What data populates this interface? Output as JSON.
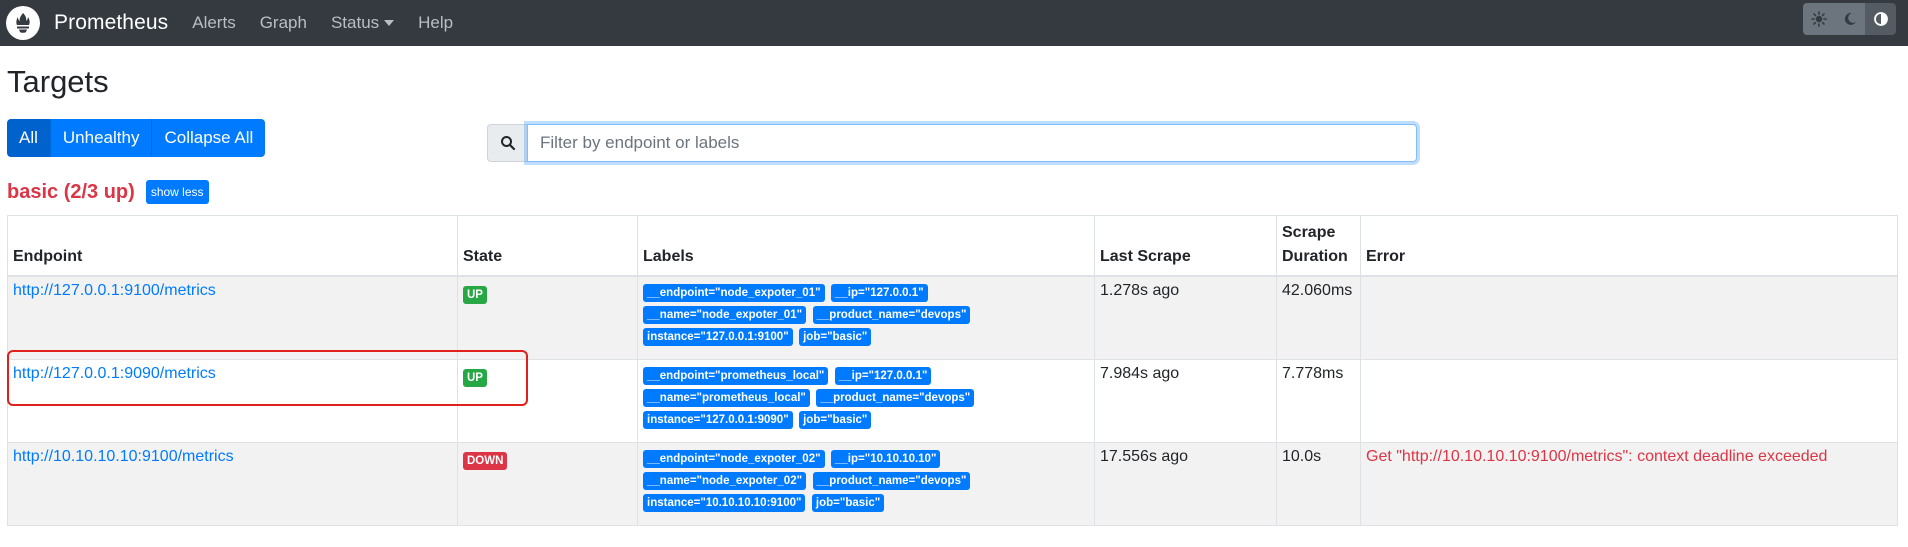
{
  "navbar": {
    "brand": "Prometheus",
    "links": [
      "Alerts",
      "Graph",
      "Status",
      "Help"
    ],
    "theme_icons": [
      "sun-icon",
      "moon-icon",
      "adjust-icon"
    ]
  },
  "page": {
    "title": "Targets"
  },
  "filter_buttons": [
    "All",
    "Unhealthy",
    "Collapse All"
  ],
  "search": {
    "placeholder": "Filter by endpoint or labels"
  },
  "pool": {
    "title": "basic (2/3 up)",
    "toggle_label": "show less"
  },
  "table": {
    "headers": {
      "endpoint": "Endpoint",
      "state": "State",
      "labels": "Labels",
      "last_scrape": "Last Scrape",
      "scrape_duration_1": "Scrape",
      "scrape_duration_2": "Duration",
      "error": "Error"
    },
    "rows": [
      {
        "endpoint": "http://127.0.0.1:9100/metrics",
        "state": "UP",
        "labels": [
          "__endpoint=\"node_expoter_01\"",
          "__ip=\"127.0.0.1\"",
          "__name=\"node_expoter_01\"",
          "__product_name=\"devops\"",
          "instance=\"127.0.0.1:9100\"",
          "job=\"basic\""
        ],
        "last_scrape": "1.278s ago",
        "scrape_duration": "42.060ms",
        "error": ""
      },
      {
        "endpoint": "http://127.0.0.1:9090/metrics",
        "state": "UP",
        "labels": [
          "__endpoint=\"prometheus_local\"",
          "__ip=\"127.0.0.1\"",
          "__name=\"prometheus_local\"",
          "__product_name=\"devops\"",
          "instance=\"127.0.0.1:9090\"",
          "job=\"basic\""
        ],
        "last_scrape": "7.984s ago",
        "scrape_duration": "7.778ms",
        "error": ""
      },
      {
        "endpoint": "http://10.10.10.10:9100/metrics",
        "state": "DOWN",
        "labels": [
          "__endpoint=\"node_expoter_02\"",
          "__ip=\"10.10.10.10\"",
          "__name=\"node_expoter_02\"",
          "__product_name=\"devops\"",
          "instance=\"10.10.10.10:9100\"",
          "job=\"basic\""
        ],
        "last_scrape": "17.556s ago",
        "scrape_duration": "10.0s",
        "error": "Get \"http://10.10.10.10:9100/metrics\": context deadline exceeded"
      }
    ]
  },
  "colors": {
    "navbar_bg": "#343a40",
    "primary": "#007bff",
    "success": "#28a745",
    "danger": "#dc3545",
    "highlight_box": "#e0201a"
  }
}
